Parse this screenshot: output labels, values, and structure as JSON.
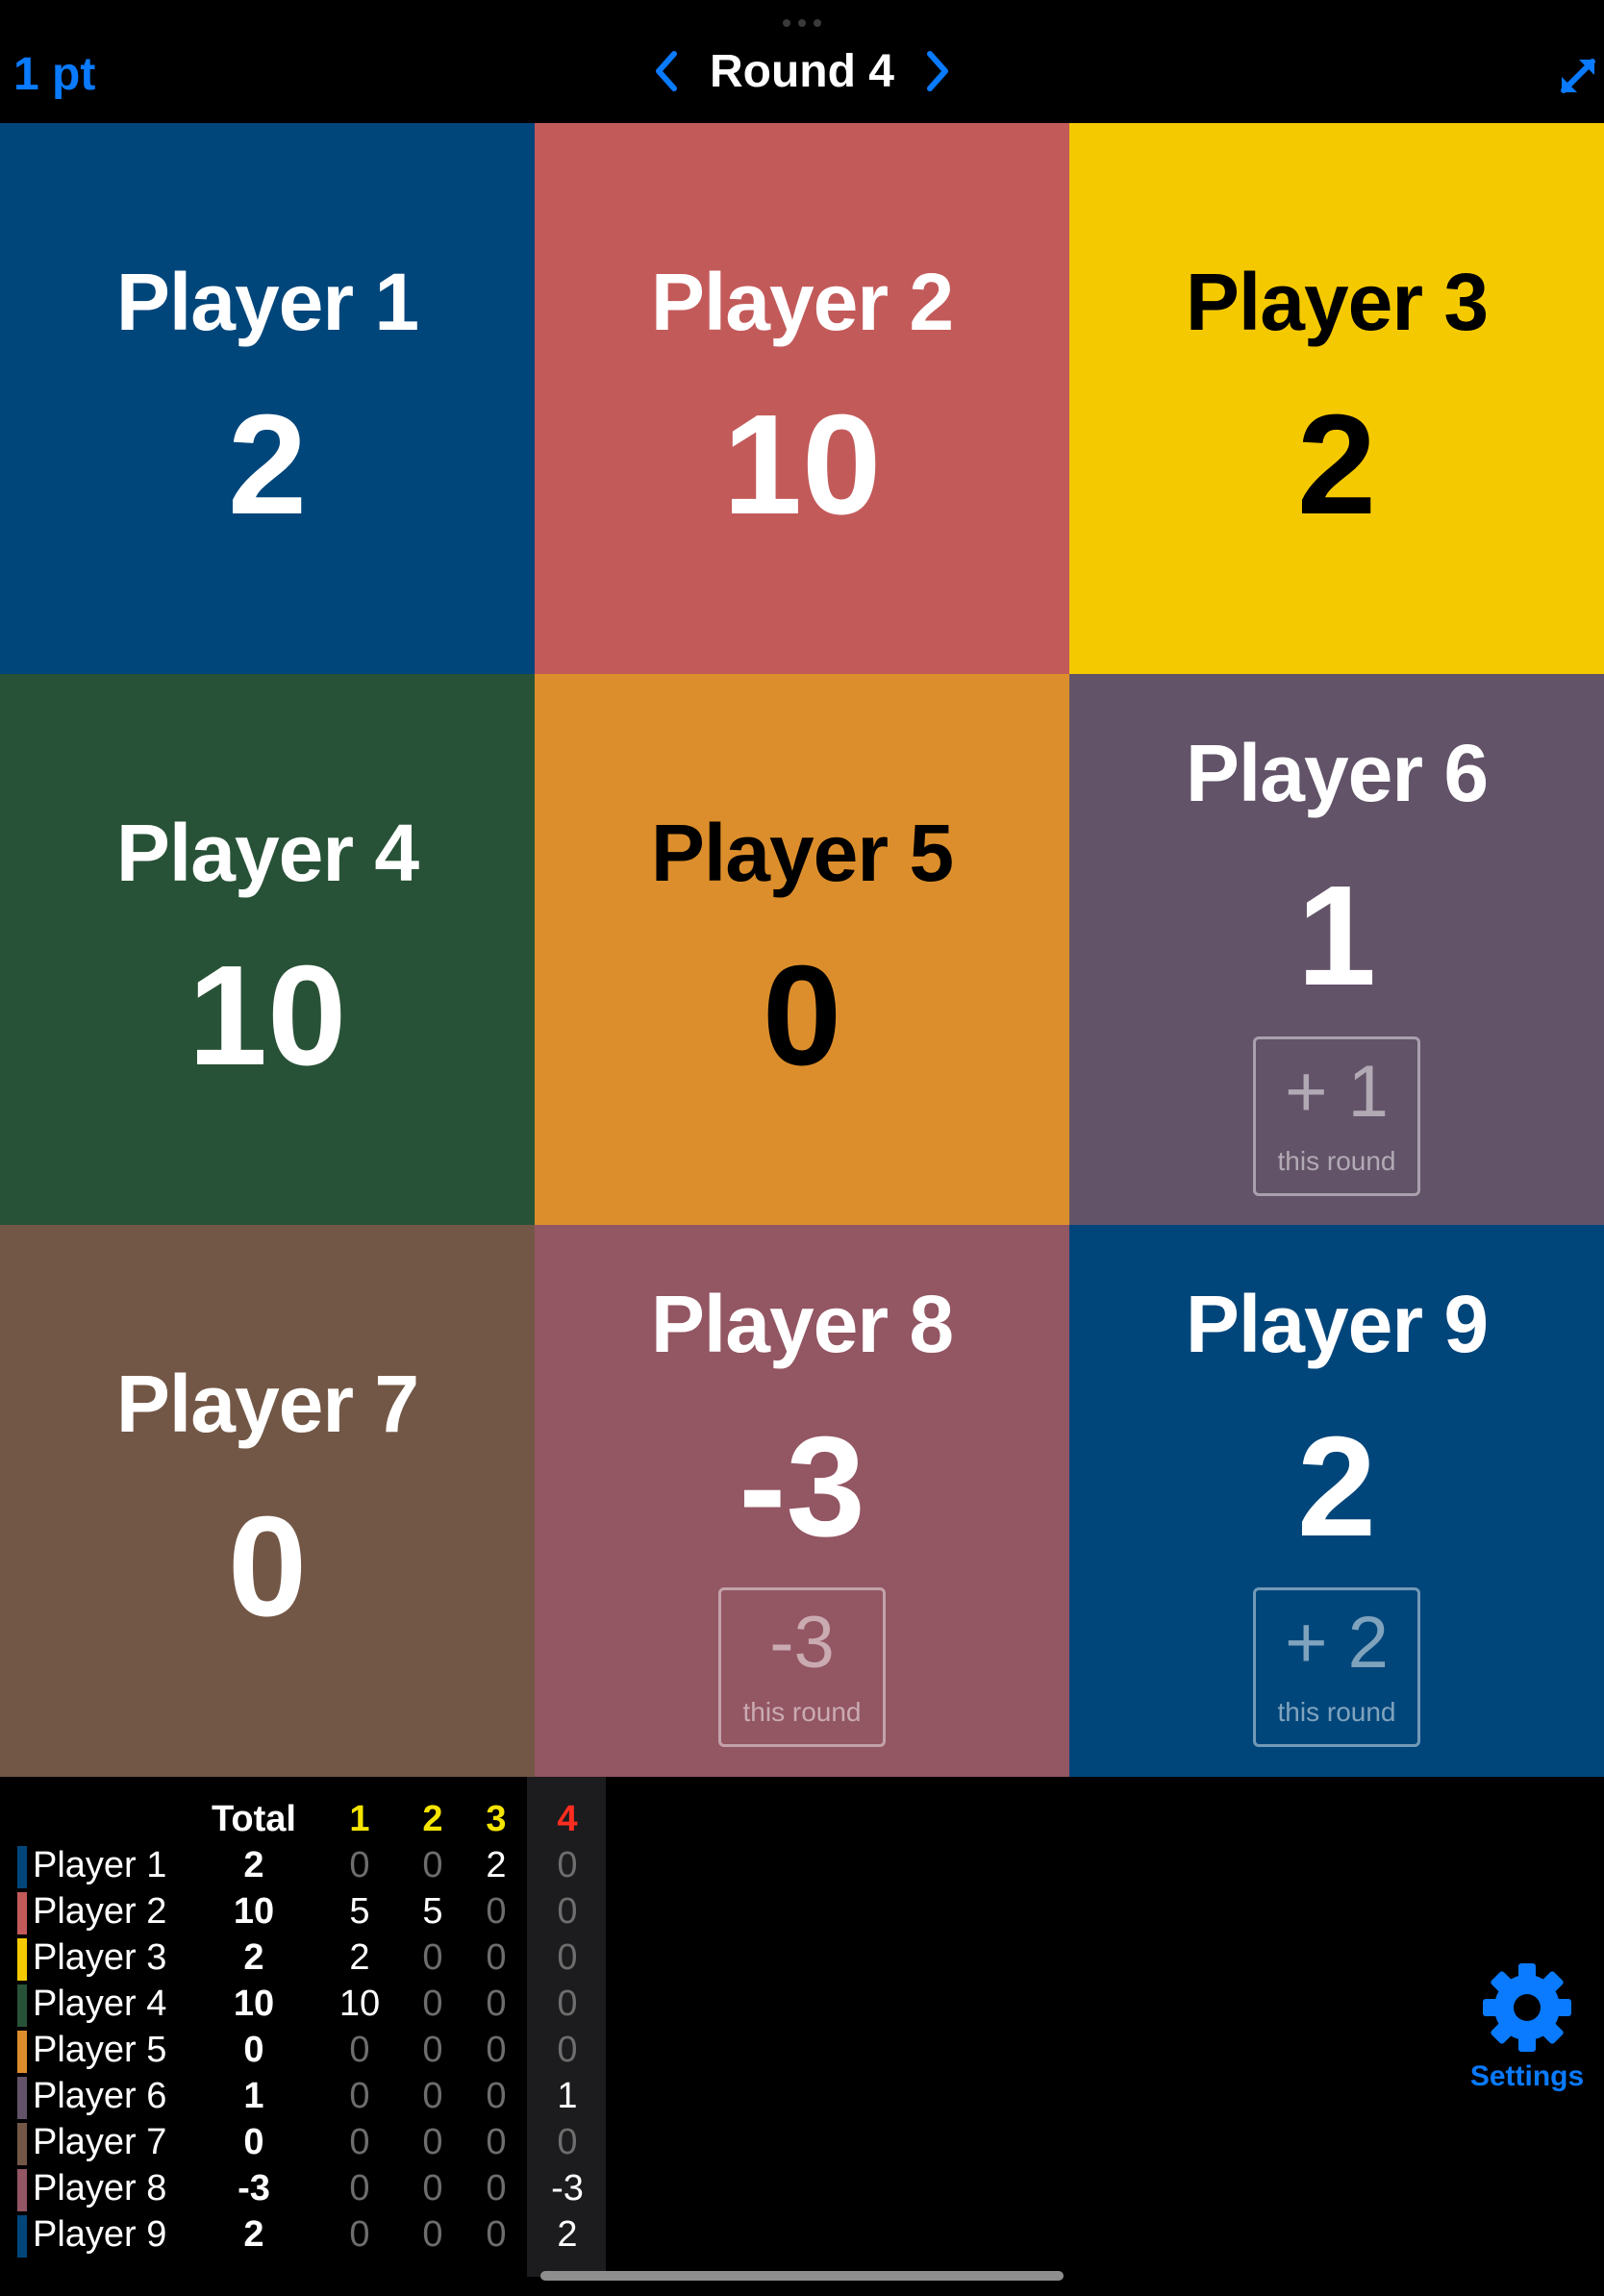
{
  "header": {
    "points_label": "1 pt",
    "round_title": "Round 4",
    "accent_color": "#0a7aff"
  },
  "tiles": [
    {
      "name": "Player 1",
      "score": "2",
      "color": "#01467b",
      "text_color": "#ffffff",
      "delta": null
    },
    {
      "name": "Player 2",
      "score": "10",
      "color": "#c35a5a",
      "text_color": "#ffffff",
      "delta": null
    },
    {
      "name": "Player 3",
      "score": "2",
      "color": "#f5c900",
      "text_color": "#000000",
      "delta": null
    },
    {
      "name": "Player 4",
      "score": "10",
      "color": "#285237",
      "text_color": "#ffffff",
      "delta": null
    },
    {
      "name": "Player 5",
      "score": "0",
      "color": "#dc8e2c",
      "text_color": "#000000",
      "delta": null
    },
    {
      "name": "Player 6",
      "score": "1",
      "color": "#625368",
      "text_color": "#ffffff",
      "delta": {
        "value": "+ 1",
        "label": "this round"
      }
    },
    {
      "name": "Player 7",
      "score": "0",
      "color": "#735746",
      "text_color": "#ffffff",
      "delta": null
    },
    {
      "name": "Player 8",
      "score": "-3",
      "color": "#935663",
      "text_color": "#ffffff",
      "delta": {
        "value": "-3",
        "label": "this round"
      }
    },
    {
      "name": "Player 9",
      "score": "2",
      "color": "#01467b",
      "text_color": "#ffffff",
      "delta": {
        "value": "+ 2",
        "label": "this round"
      }
    }
  ],
  "scoreboard": {
    "headers": {
      "total": "Total",
      "r1": "1",
      "r2": "2",
      "r3": "3",
      "r4": "4"
    },
    "header_colors": {
      "past": "#f5e400",
      "current": "#ff2d20"
    },
    "rows": [
      {
        "name": "Player 1",
        "color": "#01467b",
        "total": "2",
        "r1": "0",
        "r2": "0",
        "r3": "2",
        "r4": "0"
      },
      {
        "name": "Player 2",
        "color": "#c35a5a",
        "total": "10",
        "r1": "5",
        "r2": "5",
        "r3": "0",
        "r4": "0"
      },
      {
        "name": "Player 3",
        "color": "#f5c900",
        "total": "2",
        "r1": "2",
        "r2": "0",
        "r3": "0",
        "r4": "0"
      },
      {
        "name": "Player 4",
        "color": "#285237",
        "total": "10",
        "r1": "10",
        "r2": "0",
        "r3": "0",
        "r4": "0"
      },
      {
        "name": "Player 5",
        "color": "#dc8e2c",
        "total": "0",
        "r1": "0",
        "r2": "0",
        "r3": "0",
        "r4": "0"
      },
      {
        "name": "Player 6",
        "color": "#625368",
        "total": "1",
        "r1": "0",
        "r2": "0",
        "r3": "0",
        "r4": "1"
      },
      {
        "name": "Player 7",
        "color": "#735746",
        "total": "0",
        "r1": "0",
        "r2": "0",
        "r3": "0",
        "r4": "0"
      },
      {
        "name": "Player 8",
        "color": "#935663",
        "total": "-3",
        "r1": "0",
        "r2": "0",
        "r3": "0",
        "r4": "-3"
      },
      {
        "name": "Player 9",
        "color": "#01467b",
        "total": "2",
        "r1": "0",
        "r2": "0",
        "r3": "0",
        "r4": "2"
      }
    ]
  },
  "settings": {
    "label": "Settings",
    "icon": "gear-icon"
  }
}
